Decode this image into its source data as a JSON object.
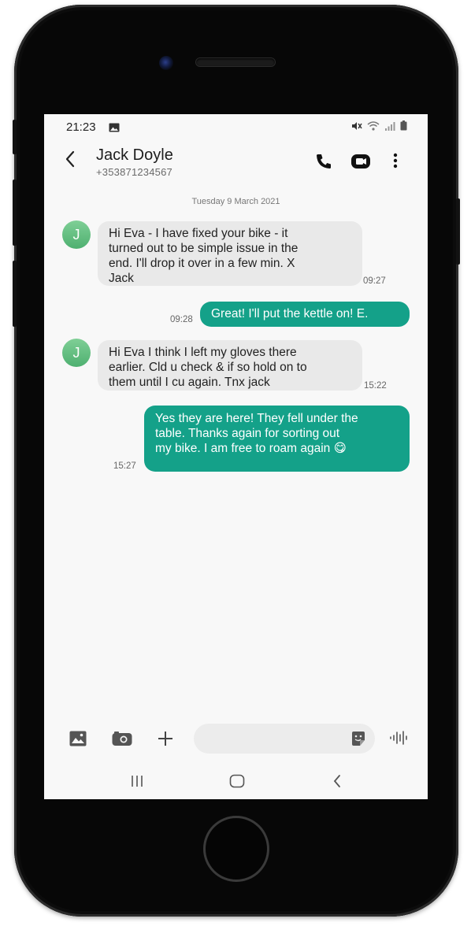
{
  "status_bar": {
    "time": "21:23"
  },
  "header": {
    "contact_name": "Jack Doyle",
    "contact_number": "+353871234567"
  },
  "conversation": {
    "date_separator": "Tuesday 9 March 2021",
    "messages": [
      {
        "direction": "incoming",
        "avatar_letter": "J",
        "lines": [
          "Hi Eva - I have fixed your bike - it",
          "turned out to be simple issue in the",
          "end. I'll drop it over in a few min. X",
          "Jack"
        ],
        "time": "09:27"
      },
      {
        "direction": "outgoing",
        "lines": [
          "Great! I'll put  the kettle on! E."
        ],
        "time": "09:28"
      },
      {
        "direction": "incoming",
        "avatar_letter": "J",
        "lines": [
          "Hi Eva I think I left my gloves there",
          "earlier. Cld u check & if so hold on to",
          "them until I cu again. Tnx jack"
        ],
        "time": "15:22"
      },
      {
        "direction": "outgoing",
        "lines": [
          "Yes they are here! They fell under the",
          "table. Thanks again for sorting out",
          "my bike. I am free to roam again 😋"
        ],
        "time": "15:27"
      }
    ]
  },
  "composer": {
    "placeholder": ""
  },
  "colors": {
    "outgoing_bubble": "#14a189",
    "incoming_bubble": "#e9e9e9",
    "avatar": "#5cbb7c",
    "screen_background": "#f8f8f8"
  },
  "icons": [
    "gallery-icon",
    "mute-icon",
    "wifi-icon",
    "signal-icon",
    "battery-icon",
    "back-icon",
    "phone-call-icon",
    "video-call-icon",
    "more-options-icon",
    "image-icon",
    "camera-icon",
    "plus-icon",
    "sticker-icon",
    "voice-icon",
    "recents-nav-icon",
    "home-nav-icon",
    "back-nav-icon"
  ]
}
